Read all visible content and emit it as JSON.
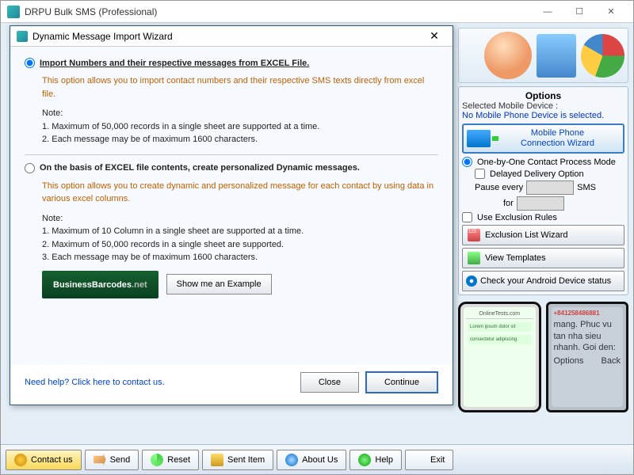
{
  "main": {
    "title": "DRPU Bulk SMS (Professional)"
  },
  "dialog": {
    "title": "Dynamic Message Import Wizard",
    "option1": {
      "label": "Import Numbers and their respective messages from EXCEL File.",
      "desc": "This option allows you to import contact numbers and their respective SMS texts directly from excel file.",
      "note_head": "Note:",
      "note1": "1. Maximum of 50,000 records in a single sheet are supported at a time.",
      "note2": "2. Each message may be of maximum 1600 characters."
    },
    "option2": {
      "label": "On the basis of EXCEL file contents, create personalized Dynamic messages.",
      "desc": "This option allows you to create dynamic and personalized message for each contact by using data in various excel columns.",
      "note_head": "Note:",
      "note1": "1. Maximum of 10 Column in a single sheet are supported at a time.",
      "note2": "2. Maximum of 50,000 records in a single sheet are supported.",
      "note3": "3. Each message may be of maximum 1600 characters."
    },
    "banner_main": "BusinessBarcodes",
    "banner_suffix": ".net",
    "example_btn": "Show me an Example",
    "help_link": "Need help? Click here to contact us.",
    "close_btn": "Close",
    "continue_btn": "Continue"
  },
  "options": {
    "title": "Options",
    "device_label": "Selected Mobile Device :",
    "device_status": "No Mobile Phone Device is selected.",
    "conn_line1": "Mobile Phone",
    "conn_line2": "Connection  Wizard",
    "mode_label": "One-by-One Contact Process Mode",
    "delayed_label": "Delayed Delivery Option",
    "pause_label": "Pause every",
    "sms_suffix": "SMS",
    "for_label": "for",
    "exclusion_label": "Use Exclusion Rules",
    "exclusion_btn": "Exclusion List Wizard",
    "templates_btn": "View Templates",
    "android_btn": "Check your Android Device status"
  },
  "phones": {
    "p1_header": "OnlineTests.com",
    "p2_number": "+841258486881",
    "p2_text": "mang. Phuc vu tan nha sieu nhanh. Goi den:",
    "p2_opt1": "Options",
    "p2_opt2": "Back"
  },
  "toolbar": {
    "contact": "Contact us",
    "send": "Send",
    "reset": "Reset",
    "sent_item": "Sent Item",
    "about": "About Us",
    "help": "Help",
    "exit": "Exit"
  }
}
